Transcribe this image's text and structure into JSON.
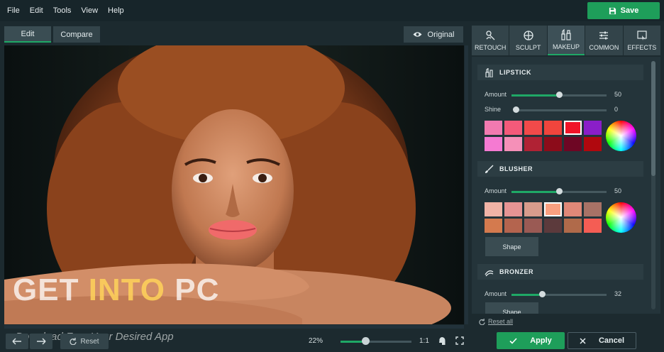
{
  "menu": [
    "File",
    "Edit",
    "Tools",
    "View",
    "Help"
  ],
  "save_label": "Save",
  "view_tabs": {
    "edit": "Edit",
    "compare": "Compare",
    "original": "Original"
  },
  "watermark": {
    "part1": "GET ",
    "part2": "INTO",
    "part3": " PC",
    "subtitle": "Download Free Your Desired App"
  },
  "bottom": {
    "reset": "Reset",
    "zoom": "22%",
    "zoom_value": 0.35,
    "one_to_one": "1:1",
    "apply": "Apply",
    "cancel": "Cancel"
  },
  "tabs": [
    {
      "label": "RETOUCH",
      "icon": "retouch-icon"
    },
    {
      "label": "SCULPT",
      "icon": "sculpt-icon"
    },
    {
      "label": "MAKEUP",
      "icon": "makeup-icon"
    },
    {
      "label": "COMMON",
      "icon": "sliders-icon"
    },
    {
      "label": "EFFECTS",
      "icon": "effects-icon"
    }
  ],
  "active_tab": "MAKEUP",
  "lipstick": {
    "title": "LIPSTICK",
    "amount_label": "Amount",
    "amount": "50",
    "amount_value": 0.5,
    "shine_label": "Shine",
    "shine": "0",
    "shine_value": 0.0,
    "swatches": [
      "#f27ab0",
      "#f45a7a",
      "#f24a4a",
      "#f0453d",
      "#f01428",
      "#8a1ec8",
      "#f57ad2",
      "#f590b8",
      "#b02234",
      "#8c0c1a",
      "#6e0624",
      "#b0080e"
    ],
    "selected_swatch": 4
  },
  "blusher": {
    "title": "BLUSHER",
    "amount_label": "Amount",
    "amount": "50",
    "amount_value": 0.5,
    "swatches": [
      "#f1b3a6",
      "#e69494",
      "#d89c8c",
      "#f9a080",
      "#e08878",
      "#a87266",
      "#d47a4e",
      "#b4644e",
      "#9a5a54",
      "#5c3a3c",
      "#b06a4a",
      "#f45d54"
    ],
    "selected_swatch": 3,
    "shape_label": "Shape"
  },
  "bronzer": {
    "title": "BRONZER",
    "amount_label": "Amount",
    "amount": "32",
    "amount_value": 0.32,
    "shape_label": "Shape"
  },
  "reset_all": "Reset all",
  "colors": {
    "accent": "#1fa866",
    "button_green": "#1e9e5a",
    "panel": "#24343a",
    "bg": "#1c2a2f"
  }
}
